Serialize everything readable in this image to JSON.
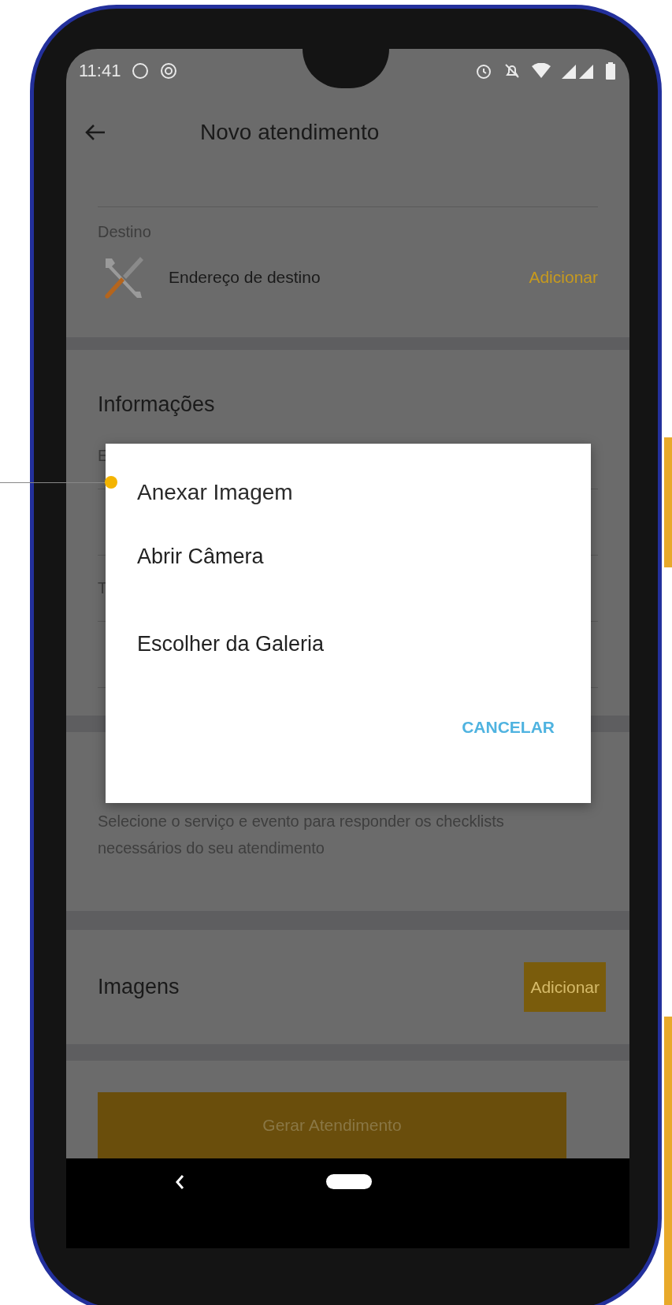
{
  "status_bar": {
    "time": "11:41"
  },
  "header": {
    "title": "Novo atendimento"
  },
  "destination": {
    "label": "Destino",
    "address": "Endereço de destino",
    "action": "Adicionar"
  },
  "info": {
    "title": "Informações",
    "rows": [
      {
        "label": "E"
      },
      {},
      {
        "label": "T"
      },
      {}
    ]
  },
  "checklist": {
    "description": "Selecione o serviço e evento para responder os checklists necessários do seu atendimento"
  },
  "images": {
    "title": "Imagens",
    "action": "Adicionar"
  },
  "submit": {
    "label": "Gerar Atendimento"
  },
  "dialog": {
    "title": "Anexar Imagem",
    "options": [
      "Abrir Câmera",
      "Escolher da Galeria"
    ],
    "cancel": "CANCELAR"
  }
}
